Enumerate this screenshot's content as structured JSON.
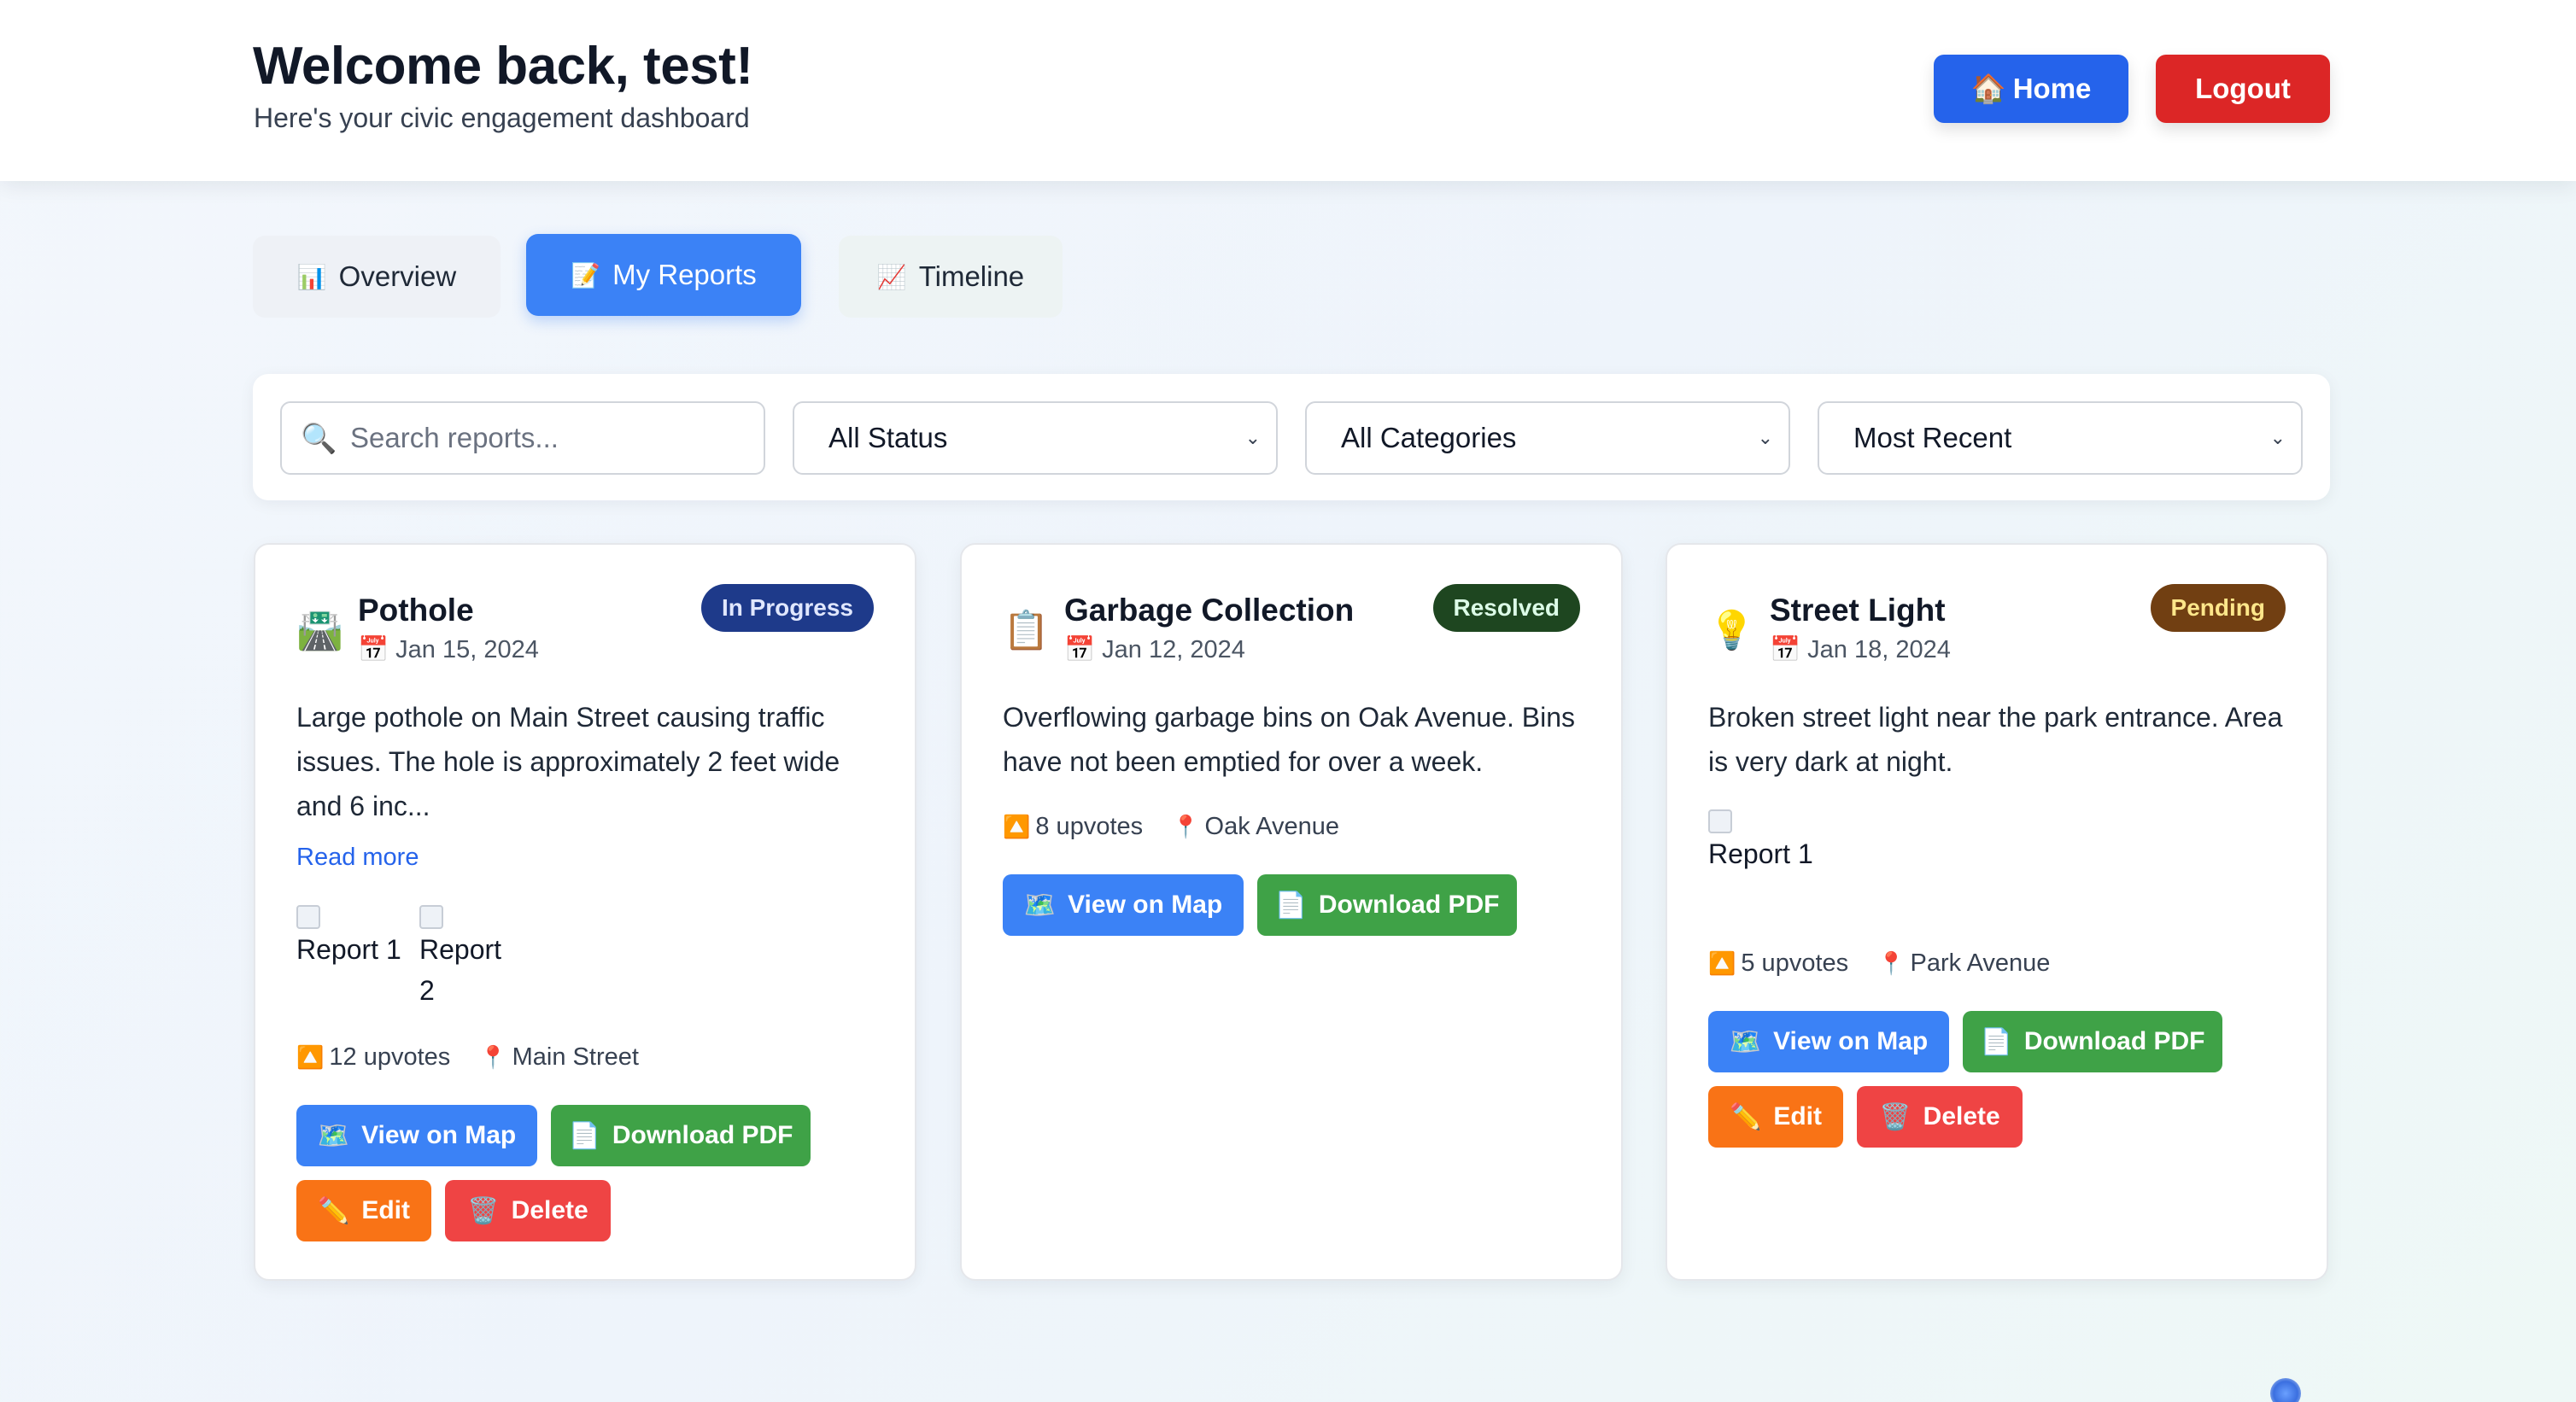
{
  "header": {
    "welcome": "Welcome back, test!",
    "subtitle": "Here's your civic engagement dashboard",
    "home_icon": "🏠",
    "home_label": "Home",
    "logout_label": "Logout"
  },
  "tabs": [
    {
      "icon": "📊",
      "label": "Overview"
    },
    {
      "icon": "📝",
      "label": "My Reports"
    },
    {
      "icon": "📈",
      "label": "Timeline"
    }
  ],
  "filters": {
    "search_icon": "🔍",
    "search_placeholder": "Search reports...",
    "status": "All Status",
    "category": "All Categories",
    "sort": "Most Recent",
    "chevron": "⌄"
  },
  "reports": [
    {
      "icon": "🛣️",
      "title": "Pothole",
      "date": "📅 Jan 15, 2024",
      "status": "In Progress",
      "description": "Large pothole on Main Street causing traffic issues. The hole is approximately 2 feet wide and 6 inc...",
      "read_more": "Read more",
      "images": [
        "Report 1",
        "Report 2"
      ],
      "upvotes": "12 upvotes",
      "location": "Main Street"
    },
    {
      "icon": "📋",
      "title": "Garbage Collection",
      "date": "📅 Jan 12, 2024",
      "status": "Resolved",
      "description": "Overflowing garbage bins on Oak Avenue. Bins have not been emptied for over a week.",
      "upvotes": "8 upvotes",
      "location": "Oak Avenue"
    },
    {
      "icon": "💡",
      "title": "Street Light",
      "date": "📅 Jan 18, 2024",
      "status": "Pending",
      "description": "Broken street light near the park entrance. Area is very dark at night.",
      "images": [
        "Report 1"
      ],
      "upvotes": "5 upvotes",
      "location": "Park Avenue"
    }
  ],
  "actions": {
    "upvote_icon": "🔼",
    "location_icon": "📍",
    "map_icon": "🗺️",
    "map_label": "View on Map",
    "pdf_icon": "📄",
    "pdf_label": "Download PDF",
    "edit_icon": "✏️",
    "edit_label": "Edit",
    "delete_icon": "🗑️",
    "delete_label": "Delete"
  },
  "colors": {
    "primary": "#3b82f6",
    "home_button": "#2563eb",
    "logout_button": "#dc2626",
    "pdf_button": "#3fa247",
    "edit_button": "#f97316",
    "delete_button": "#ef4444"
  }
}
